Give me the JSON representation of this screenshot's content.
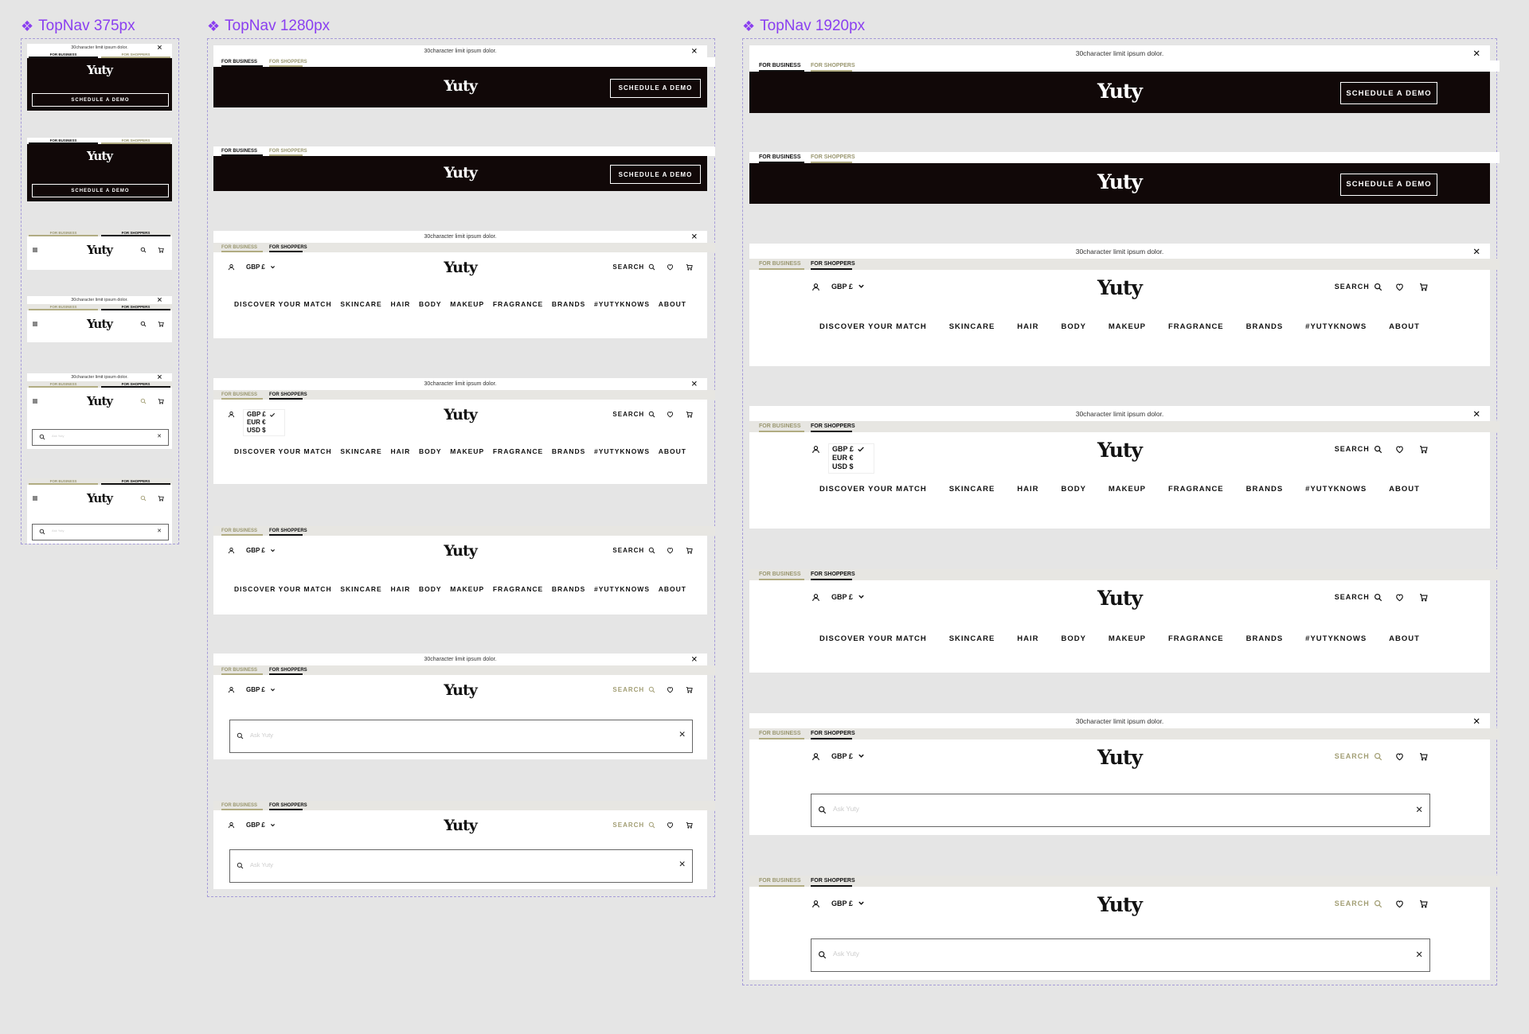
{
  "frames": {
    "mobile": {
      "title": "TopNav 375px"
    },
    "medium": {
      "title": "TopNav 1280px"
    },
    "large": {
      "title": "TopNav 1920px"
    }
  },
  "nav": {
    "announcement": "30character limit ipsum dolor.",
    "close_glyph": "✕",
    "tab_business": "FOR BUSINESS",
    "tab_shoppers": "FOR SHOPPERS",
    "logo": "Yuty",
    "schedule_demo": "SCHEDULE A DEMO",
    "currency": "GBP £",
    "currency_options": [
      "GBP £",
      "EUR €",
      "USD $"
    ],
    "search_label": "SEARCH",
    "search_placeholder": "Ask Yuty",
    "menu_items": [
      "DISCOVER YOUR MATCH",
      "SKINCARE",
      "HAIR",
      "BODY",
      "MAKEUP",
      "FRAGRANCE",
      "BRANDS",
      "#YUTYKNOWS",
      "ABOUT"
    ]
  },
  "colors": {
    "frame_label": "#8a3ff0",
    "dark_bar": "#110808",
    "accent_gold": "#a29e74",
    "canvas": "#e5e5e5"
  },
  "icons": [
    "user-icon",
    "search-icon",
    "heart-icon",
    "cart-icon",
    "close-icon",
    "chevron-down-icon",
    "hamburger-icon",
    "check-icon"
  ]
}
